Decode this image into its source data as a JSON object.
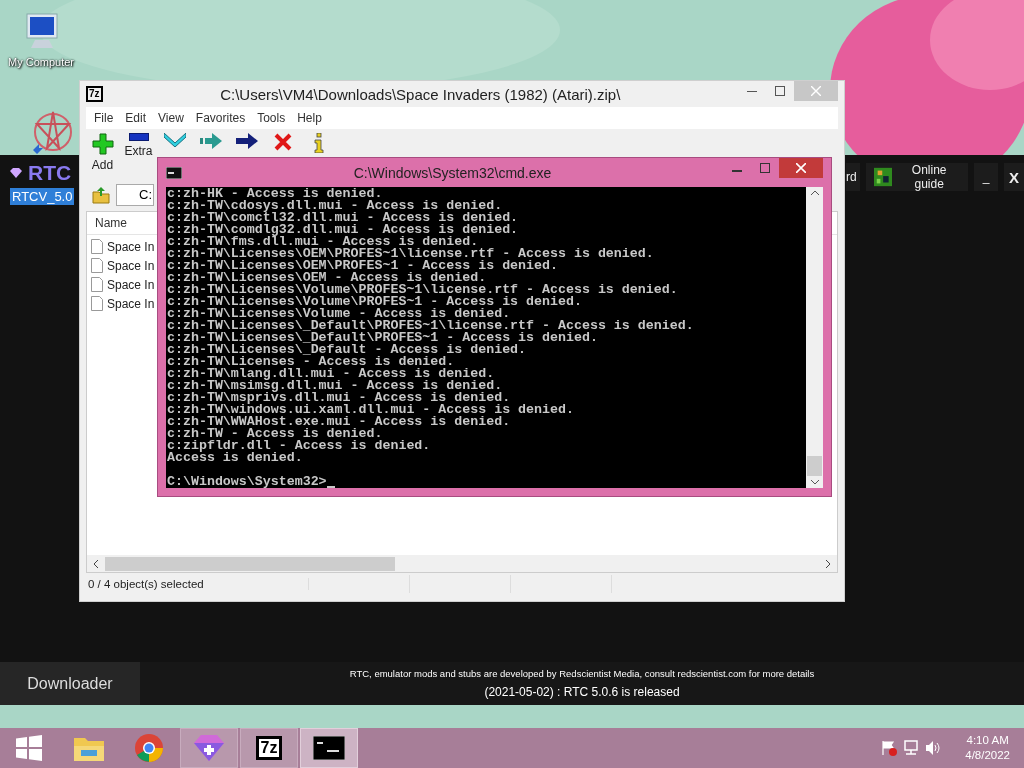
{
  "desktop_icons": [
    {
      "kind": "computer",
      "label": "My Computer"
    },
    {
      "kind": "rtc-shortcut"
    }
  ],
  "rtc_window": {
    "logo": "RTC",
    "version_label": "RTCV_5.0",
    "header_buttons": [
      {
        "kind": "text",
        "label": "rd"
      },
      {
        "kind": "guide",
        "label": "Online guide"
      },
      {
        "kind": "text",
        "label": "_"
      },
      {
        "kind": "text",
        "label": "X"
      }
    ],
    "tabs": [
      {
        "label": "Downloader"
      }
    ],
    "footer": {
      "credits": "RTC, emulator mods and stubs are developed by Redscientist Media, consult redscientist.com for more details",
      "news": "(2021-05-02) : RTC 5.0.6 is released"
    }
  },
  "archive_window": {
    "icon_text": "7z",
    "title": "C:\\Users\\VM4\\Downloads\\Space Invaders (1982) (Atari).zip\\",
    "menu": [
      "File",
      "Edit",
      "View",
      "Favorites",
      "Tools",
      "Help"
    ],
    "toolbar": [
      {
        "kind": "add",
        "label": "Add"
      },
      {
        "kind": "extract",
        "label": "Extra"
      },
      {
        "kind": "test"
      },
      {
        "kind": "copy"
      },
      {
        "kind": "move"
      },
      {
        "kind": "delete"
      },
      {
        "kind": "info"
      }
    ],
    "address": "C:",
    "columns": [
      "Name"
    ],
    "files": [
      "Space In",
      "Space In",
      "Space In",
      "Space In"
    ],
    "status_bar": [
      "0 / 4 object(s) selected"
    ]
  },
  "console_window": {
    "title": "C:\\Windows\\System32\\cmd.exe",
    "lines": [
      "c:zh-HK - Access is denied.",
      "c:zh-TW\\cdosys.dll.mui - Access is denied.",
      "c:zh-TW\\comctl32.dll.mui - Access is denied.",
      "c:zh-TW\\comdlg32.dll.mui - Access is denied.",
      "c:zh-TW\\fms.dll.mui - Access is denied.",
      "c:zh-TW\\Licenses\\OEM\\PROFES~1\\license.rtf - Access is denied.",
      "c:zh-TW\\Licenses\\OEM\\PROFES~1 - Access is denied.",
      "c:zh-TW\\Licenses\\OEM - Access is denied.",
      "c:zh-TW\\Licenses\\Volume\\PROFES~1\\license.rtf - Access is denied.",
      "c:zh-TW\\Licenses\\Volume\\PROFES~1 - Access is denied.",
      "c:zh-TW\\Licenses\\Volume - Access is denied.",
      "c:zh-TW\\Licenses\\_Default\\PROFES~1\\license.rtf - Access is denied.",
      "c:zh-TW\\Licenses\\_Default\\PROFES~1 - Access is denied.",
      "c:zh-TW\\Licenses\\_Default - Access is denied.",
      "c:zh-TW\\Licenses - Access is denied.",
      "c:zh-TW\\mlang.dll.mui - Access is denied.",
      "c:zh-TW\\msimsg.dll.mui - Access is denied.",
      "c:zh-TW\\msprivs.dll.mui - Access is denied.",
      "c:zh-TW\\windows.ui.xaml.dll.mui - Access is denied.",
      "c:zh-TW\\WWAHost.exe.mui - Access is denied.",
      "c:zh-TW - Access is denied.",
      "c:zipfldr.dll - Access is denied.",
      "Access is denied."
    ],
    "prompt": "C:\\Windows\\System32>"
  },
  "taskbar": {
    "apps": [
      {
        "kind": "start",
        "open": false,
        "selected": false
      },
      {
        "kind": "explorer",
        "open": false,
        "selected": false
      },
      {
        "kind": "chrome",
        "open": false,
        "selected": false
      },
      {
        "kind": "rtc",
        "open": true,
        "selected": false
      },
      {
        "kind": "sevenzip",
        "label": "7z",
        "open": true,
        "selected": false
      },
      {
        "kind": "console",
        "open": true,
        "selected": true
      }
    ],
    "clock": {
      "time": "4:10 AM",
      "date": "4/8/2022"
    }
  }
}
